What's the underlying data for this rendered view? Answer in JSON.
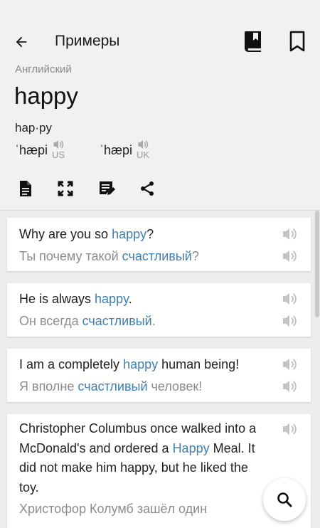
{
  "header": {
    "title": "Примеры",
    "back_icon": "arrow-back-icon",
    "dictionary_icon": "book-icon",
    "bookmark_icon": "bookmark-icon"
  },
  "entry": {
    "language": "Английский",
    "word": "happy",
    "syllables": "hap·py",
    "pronunciations": [
      {
        "ipa": "ˈhæpi",
        "region": "US"
      },
      {
        "ipa": "ˈhæpi",
        "region": "UK"
      }
    ]
  },
  "toolbar": [
    "document-icon",
    "fullscreen-icon",
    "edit-note-icon",
    "share-icon"
  ],
  "examples": [
    {
      "en": {
        "before": "Why are you so ",
        "hl": "happy",
        "after": "?"
      },
      "ru": {
        "before": "Ты почему такой ",
        "hl": "счастливый",
        "after": "?"
      }
    },
    {
      "en": {
        "before": "He is always ",
        "hl": "happy",
        "after": "."
      },
      "ru": {
        "before": "Он всегда ",
        "hl": "счастливый",
        "after": "."
      }
    },
    {
      "en": {
        "before": "I am a completely ",
        "hl": "happy",
        "after": " human being!"
      },
      "ru": {
        "before": "Я вполне ",
        "hl": "счастливый",
        "after": " человек!"
      }
    },
    {
      "en": {
        "before": "Christopher Columbus once walked into a McDonald's and ordered a ",
        "hl": "Happy",
        "after": " Meal. It did not make him happy, but he liked the toy."
      },
      "ru": {
        "before": "Христофор Колумб зашёл один",
        "hl": "",
        "after": ""
      }
    }
  ],
  "colors": {
    "highlight": "#3c7fbd",
    "translation": "#8c8c8c",
    "background": "#ececec"
  },
  "fab": {
    "icon": "search-icon"
  }
}
